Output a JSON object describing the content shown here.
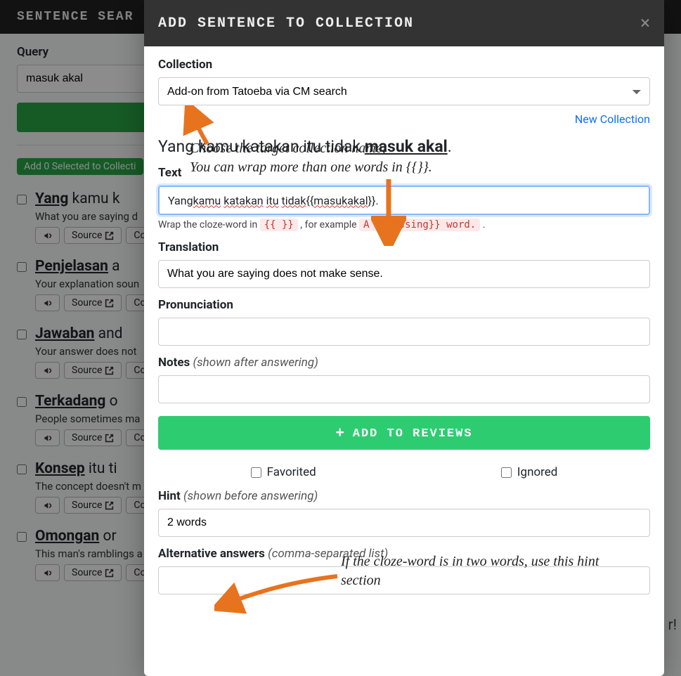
{
  "bgHeader": "Sentence Sear",
  "queryLabel": "Query",
  "queryValue": "masuk akal",
  "pill": "Add 0 Selected to Collecti",
  "results": [
    {
      "title": "Yang kamu k",
      "bold": "",
      "rest": "",
      "raw": "<b>Yang</b> kamu k",
      "sub": "What you are saying d"
    },
    {
      "title": "",
      "raw": "<b>Penjelasan</b> a",
      "sub": "Your explanation soun"
    },
    {
      "title": "",
      "raw": "<b>Jawaban</b> and",
      "sub": "Your answer does not "
    },
    {
      "title": "",
      "raw": "<b>Terkadang</b> o",
      "sub": "People sometimes ma"
    },
    {
      "title": "",
      "raw": "<b>Konsep</b> itu ti",
      "sub": "The concept doesn't m"
    },
    {
      "title": "",
      "raw": "<b>Omongan</b> or",
      "sub": "This man's ramblings a"
    }
  ],
  "btnSource": "Source",
  "btnCo": "Co",
  "modal": {
    "title": "Add Sentence To Collection",
    "collection": {
      "label": "Collection",
      "value": "Add-on from Tatoeba via CM search",
      "newLink": "New Collection"
    },
    "sentencePlain": "Yang kamu katakan itu tidak ",
    "sentenceBold": "masuk akal",
    "sentenceEnd": ".",
    "text": {
      "label": "Text",
      "prefix": "Yang ",
      "w1": "kamu",
      "w2": "katakan",
      "w3": "itu",
      "w4": "tidak",
      "mid": " {{",
      "w5": "masuk",
      "sp": " ",
      "w6": "akal",
      "suffix": "}}.",
      "helperPrefix": "Wrap the cloze-word in ",
      "helperCode1": "{{ }}",
      "helperMid": " , for example ",
      "helperCode2": "A {{missing}} word.",
      "helperEnd": " ."
    },
    "translation": {
      "label": "Translation",
      "value": "What you are saying does not make sense."
    },
    "pronunciation": {
      "label": "Pronunciation",
      "value": ""
    },
    "notes": {
      "label": "Notes",
      "labelMuted": "(shown after answering)",
      "value": ""
    },
    "addBtn": "Add to reviews",
    "favorited": "Favorited",
    "ignored": "Ignored",
    "hint": {
      "label": "Hint",
      "labelMuted": "(shown before answering)",
      "value": "2 words"
    },
    "alt": {
      "label": "Alternative answers",
      "labelMuted": "(comma-separated list)"
    }
  },
  "annotations": {
    "a1": "Choose  the target collection name,\nYou can wrap more than one words in {{}}.",
    "a2": "If the cloze-word is in two words, use this hint section",
    "rtail": "r!"
  }
}
